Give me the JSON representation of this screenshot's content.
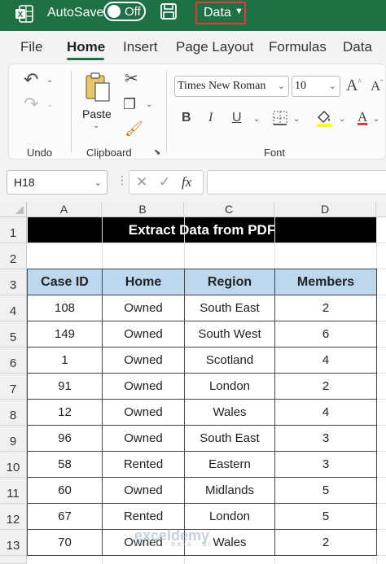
{
  "titlebar": {
    "autosave_label": "AutoSave",
    "toggle_state": "Off",
    "data_dropdown": "Data",
    "accent": "#1e7145",
    "highlight_border": "#e53935"
  },
  "tabs": [
    "File",
    "Home",
    "Insert",
    "Page Layout",
    "Formulas",
    "Data"
  ],
  "active_tab": "Home",
  "ribbon": {
    "undo_label": "Undo",
    "paste_label": "Paste",
    "clipboard_label": "Clipboard",
    "font_group_label": "Font",
    "font_name": "Times New Roman",
    "font_size": "10",
    "bold": "B",
    "italic": "I",
    "underline": "U"
  },
  "formula_bar": {
    "name_box": "H18",
    "fx": "fx",
    "content": ""
  },
  "sheet": {
    "columns": [
      "A",
      "B",
      "C",
      "D"
    ],
    "rows": [
      "1",
      "2",
      "3",
      "4",
      "5",
      "6",
      "7",
      "8",
      "9",
      "10",
      "11",
      "12",
      "13"
    ],
    "title": "Extract Data from PDF",
    "headers": [
      "Case ID",
      "Home",
      "Region",
      "Members"
    ],
    "header_fill": "#bdd7ee",
    "records": [
      [
        "108",
        "Owned",
        "South East",
        "2"
      ],
      [
        "149",
        "Owned",
        "South West",
        "6"
      ],
      [
        "1",
        "Owned",
        "Scotland",
        "4"
      ],
      [
        "91",
        "Owned",
        "London",
        "2"
      ],
      [
        "12",
        "Owned",
        "Wales",
        "4"
      ],
      [
        "96",
        "Owned",
        "South East",
        "3"
      ],
      [
        "58",
        "Rented",
        "Eastern",
        "3"
      ],
      [
        "60",
        "Owned",
        "Midlands",
        "5"
      ],
      [
        "67",
        "Rented",
        "London",
        "5"
      ],
      [
        "70",
        "Owned",
        "Wales",
        "2"
      ]
    ]
  },
  "watermark": {
    "name": "exceldemy",
    "tagline": "EXCEL · DATA · BI"
  }
}
